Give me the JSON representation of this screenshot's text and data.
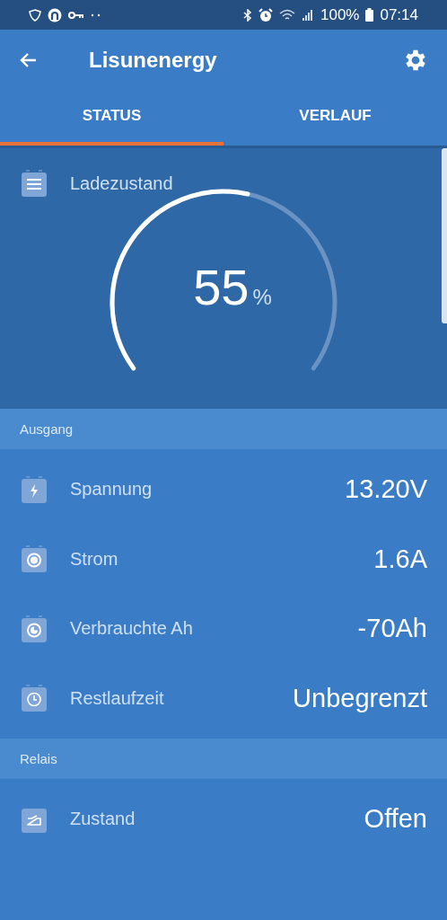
{
  "status_bar": {
    "battery": "100%",
    "time": "07:14"
  },
  "app_bar": {
    "title": "Lisunenergy"
  },
  "tabs": [
    {
      "label": "STATUS",
      "selected": true
    },
    {
      "label": "VERLAUF",
      "selected": false
    }
  ],
  "gauge": {
    "label": "Ladezustand",
    "value": "55",
    "unit": "%"
  },
  "sections": [
    {
      "title": "Ausgang",
      "rows": [
        {
          "label": "Spannung",
          "value": "13.20V"
        },
        {
          "label": "Strom",
          "value": "1.6A"
        },
        {
          "label": "Verbrauchte Ah",
          "value": "-70Ah"
        },
        {
          "label": "Restlaufzeit",
          "value": "Unbegrenzt"
        }
      ]
    },
    {
      "title": "Relais",
      "rows": [
        {
          "label": "Zustand",
          "value": "Offen"
        }
      ]
    }
  ]
}
